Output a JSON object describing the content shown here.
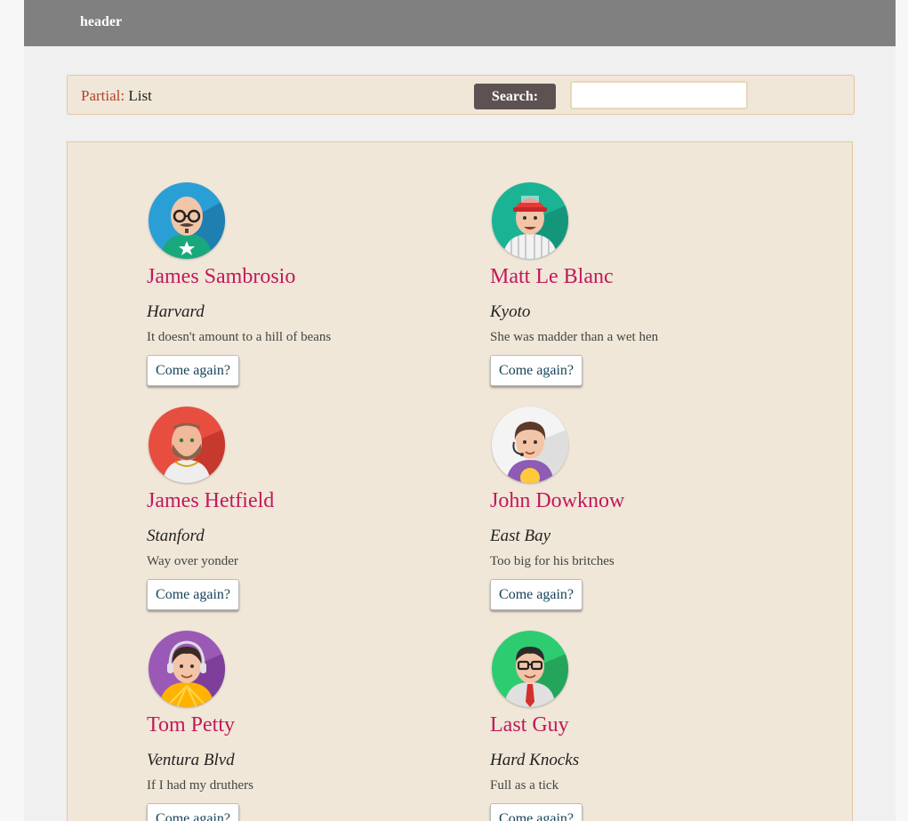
{
  "header": {
    "title": "header"
  },
  "toolbar": {
    "partial_label": "Partial:",
    "partial_value": "List",
    "search_button": "Search:",
    "search_value": "",
    "search_placeholder": ""
  },
  "people": [
    {
      "name": "James Sambrosio",
      "school": "Harvard",
      "quote": "It doesn't amount to a hill of beans",
      "button": "Come again?",
      "avatar": "bald-glasses-man-icon"
    },
    {
      "name": "Matt Le Blanc",
      "school": "Kyoto",
      "quote": "She was madder than a wet hen",
      "button": "Come again?",
      "avatar": "baseball-cap-man-icon"
    },
    {
      "name": "James Hetfield",
      "school": "Stanford",
      "quote": "Way over yonder",
      "button": "Come again?",
      "avatar": "bearded-man-icon"
    },
    {
      "name": "John Dowknow",
      "school": "East Bay",
      "quote": "Too big for his britches",
      "button": "Come again?",
      "avatar": "headset-man-icon"
    },
    {
      "name": "Tom Petty",
      "school": "Ventura Blvd",
      "quote": "If I had my druthers",
      "button": "Come again?",
      "avatar": "headphones-man-icon"
    },
    {
      "name": "Last Guy",
      "school": "Hard Knocks",
      "quote": "Full as a tick",
      "button": "Come again?",
      "avatar": "nerd-tie-man-icon"
    }
  ],
  "colors": {
    "header_bg": "#808080",
    "panel_bg": "#f0e7d8",
    "name": "#c2185b",
    "search_button_bg": "#5d5152",
    "partial_label": "#b5402a"
  }
}
